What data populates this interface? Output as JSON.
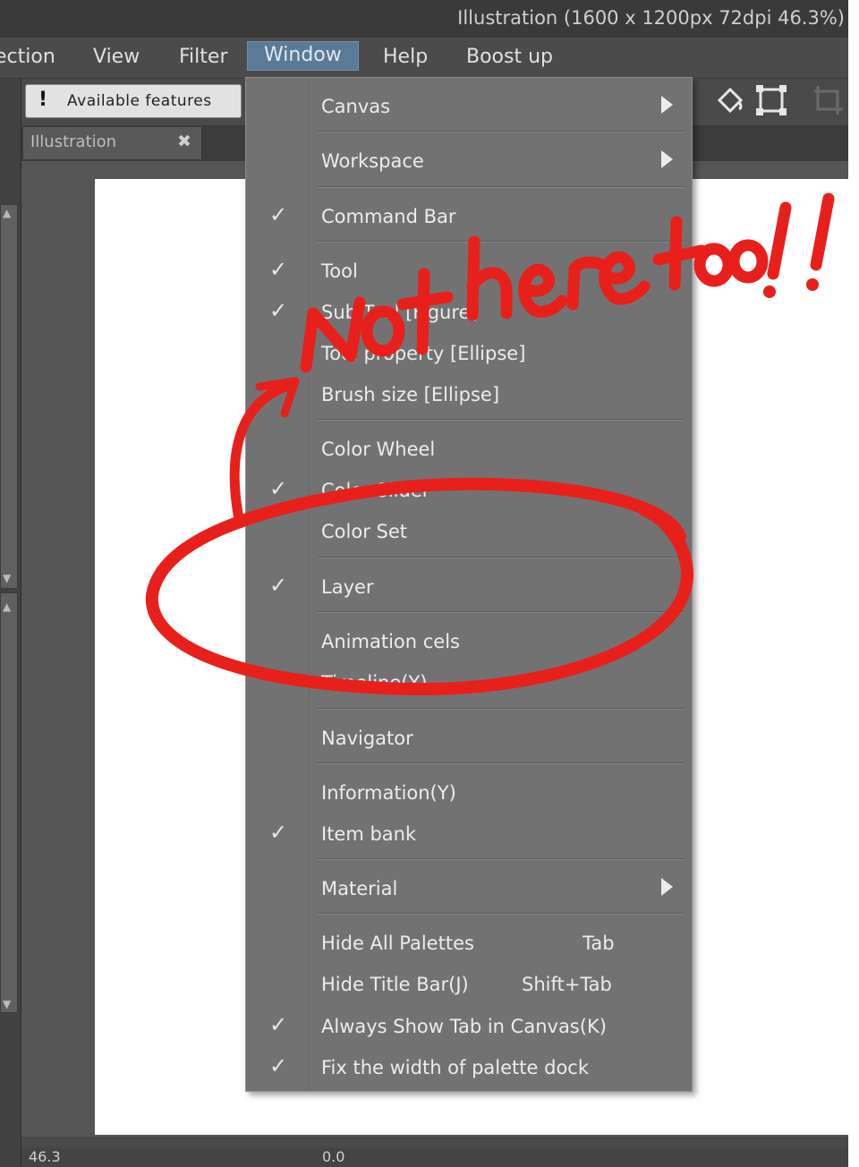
{
  "window": {
    "title": "Illustration (1600 x 1200px 72dpi 46.3%)"
  },
  "menubar": {
    "items": [
      {
        "label": "ection"
      },
      {
        "label": "View"
      },
      {
        "label": "Filter"
      },
      {
        "label": "Window",
        "active": true
      },
      {
        "label": "Help"
      },
      {
        "label": "Boost up"
      }
    ]
  },
  "command_bar": {
    "available_features_label": "Available features",
    "icons": [
      "bucket-icon",
      "transform-icon",
      "crop-icon"
    ]
  },
  "canvas_tab": {
    "label": "Illustration",
    "close_glyph": "✖"
  },
  "status_bar": {
    "zoom": "46.3",
    "angle": "0.0"
  },
  "window_menu": {
    "items": [
      {
        "label": "Canvas",
        "checked": false,
        "submenu": true
      },
      {
        "label": "Workspace",
        "checked": false,
        "submenu": true
      },
      {
        "label": "Command Bar",
        "checked": true
      },
      {
        "label": "Tool",
        "checked": true
      },
      {
        "label": "Sub Tool [Figure]",
        "checked": true
      },
      {
        "label": "Tool property [Ellipse]",
        "checked": false
      },
      {
        "label": "Brush size [Ellipse]",
        "checked": false
      },
      {
        "label": "Color Wheel",
        "checked": false
      },
      {
        "label": "Color Slider",
        "checked": true
      },
      {
        "label": "Color Set",
        "checked": false
      },
      {
        "label": "Layer",
        "checked": true
      },
      {
        "label": "Animation cels",
        "checked": false
      },
      {
        "label": "Timeline(Y)",
        "checked": false
      },
      {
        "label": "Navigator",
        "checked": false
      },
      {
        "label": "Information(Y)",
        "checked": false
      },
      {
        "label": "Item bank",
        "checked": true
      },
      {
        "label": "Material",
        "checked": false,
        "submenu": true
      },
      {
        "label": "Hide All Palettes",
        "shortcut": "Tab",
        "checked": false
      },
      {
        "label": "Hide Title Bar(J)",
        "shortcut": "Shift+Tab",
        "checked": false
      },
      {
        "label": "Always Show Tab in Canvas(K)",
        "checked": true
      },
      {
        "label": "Fix the width of palette dock",
        "checked": true
      }
    ],
    "check_glyph": "✓"
  },
  "annotation": {
    "text": "Not here too!!",
    "color": "#e8201c"
  }
}
